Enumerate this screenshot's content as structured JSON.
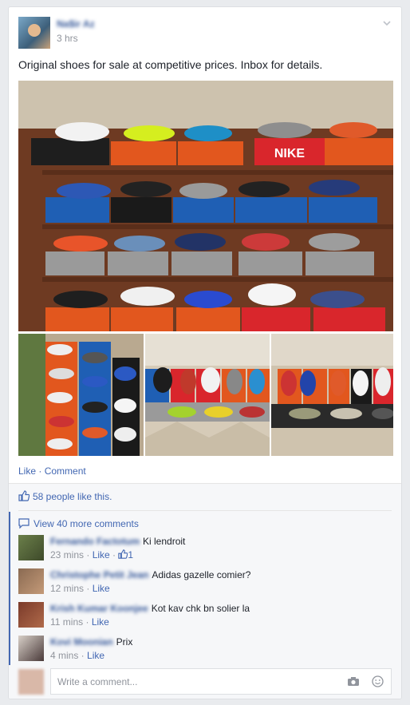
{
  "post": {
    "author": "Na$ir Az",
    "time": "3 hrs",
    "text": "Original shoes for sale at competitive prices. Inbox for details."
  },
  "actions": {
    "like": "Like",
    "separator": " · ",
    "comment": "Comment"
  },
  "likes": {
    "text": "58 people like this."
  },
  "more_comments": "View 40 more comments",
  "comments": [
    {
      "name": "Fernando Factotum",
      "text": "Ki lendroit",
      "time": "23 mins",
      "like": "Like",
      "like_count": "1"
    },
    {
      "name": "Christophe Petit Jean",
      "text": "Adidas gazelle comier?",
      "time": "12 mins",
      "like": "Like"
    },
    {
      "name": "Krish Kumar Koonjee",
      "text": "Kot kav chk bn solier la",
      "time": "11 mins",
      "like": "Like"
    },
    {
      "name": "Kovi Moonian",
      "text": "Prix",
      "time": "4 mins",
      "like": "Like"
    }
  ],
  "composer": {
    "placeholder": "Write a comment..."
  },
  "icons": {
    "chevron": "chevron-down-icon",
    "thumbs_up": "thumbs-up-icon",
    "comment_bubble": "comment-bubble-icon",
    "camera": "camera-icon",
    "smiley": "smiley-icon"
  },
  "colors": {
    "link": "#4267b2",
    "name": "#365899",
    "meta": "#90949c",
    "nike_red": "#d9262c",
    "adidas_blue": "#1f5fb4",
    "orange_box": "#e2571e"
  },
  "photo_text": {
    "nike_box_label": "NIKE"
  }
}
